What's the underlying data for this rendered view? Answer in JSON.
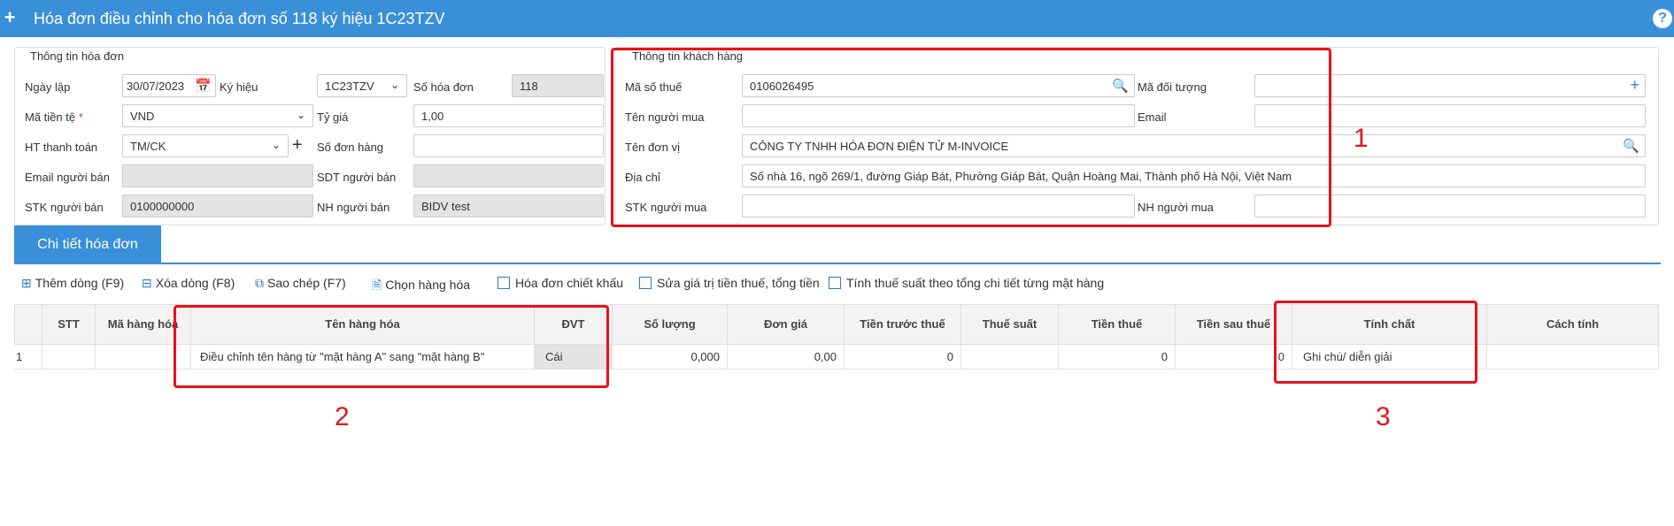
{
  "title": "Hóa đơn điều chỉnh cho hóa đơn số 118 ký hiệu 1C23TZV",
  "invoice_info": {
    "legend": "Thông tin hóa đơn",
    "ngay_lap_label": "Ngày lập",
    "ngay_lap": "30/07/2023",
    "ky_hieu_label": "Ký hiệu",
    "ky_hieu": "1C23TZV",
    "so_hoa_don_label": "Số hóa đơn",
    "so_hoa_don": "118",
    "ma_tien_te_label": "Mã tiền tệ",
    "ma_tien_te": "VND",
    "ty_gia_label": "Tỷ giá",
    "ty_gia": "1,00",
    "ht_thanh_toan_label": "HT thanh toán",
    "ht_thanh_toan": "TM/CK",
    "so_don_hang_label": "Số đơn hàng",
    "so_don_hang": "",
    "email_nguoi_ban_label": "Email người bán",
    "email_nguoi_ban": "",
    "sdt_nguoi_ban_label": "SDT người bán",
    "sdt_nguoi_ban": "",
    "stk_nguoi_ban_label": "STK người bán",
    "stk_nguoi_ban": "0100000000",
    "nh_nguoi_ban_label": "NH người bán",
    "nh_nguoi_ban": "BIDV test"
  },
  "customer_info": {
    "legend": "Thông tin khách hàng",
    "ma_so_thue_label": "Mã số thuế",
    "ma_so_thue": "0106026495",
    "ma_doi_tuong_label": "Mã đối tượng",
    "ma_doi_tuong": "",
    "ten_nguoi_mua_label": "Tên người mua",
    "ten_nguoi_mua": "",
    "email_label": "Email",
    "email": "",
    "ten_don_vi_label": "Tên đơn vị",
    "ten_don_vi": "CÔNG TY TNHH HÓA ĐƠN ĐIỆN TỬ M-INVOICE",
    "dia_chi_label": "Địa chỉ",
    "dia_chi": "Số nhà 16, ngõ 269/1, đường Giáp Bát, Phường Giáp Bát, Quận Hoàng Mai, Thành phố Hà Nội, Việt Nam",
    "stk_nguoi_mua_label": "STK người mua",
    "stk_nguoi_mua": "",
    "nh_nguoi_mua_label": "NH người mua",
    "nh_nguoi_mua": ""
  },
  "tab": "Chi tiết hóa đơn",
  "toolbar": {
    "add_row": "Thêm dòng (F9)",
    "delete_row": "Xóa dòng (F8)",
    "copy": "Sao chép (F7)",
    "choose_goods": "Chọn hàng hóa",
    "discount_invoice": "Hóa đơn chiết khấu",
    "edit_tax_total": "Sửa giá trị tiền thuế, tổng tiền",
    "calc_tax_rate": "Tính thuế suất theo tổng chi tiết từng mặt hàng"
  },
  "grid": {
    "headers": [
      "STT",
      "Mã hàng hóa",
      "Tên hàng hóa",
      "ĐVT",
      "Số lượng",
      "Đơn giá",
      "Tiền trước thuế",
      "Thuế suất",
      "Tiền thuế",
      "Tiền sau thuế",
      "Tính chất",
      "Cách tính"
    ],
    "row": {
      "index": "1",
      "stt": "",
      "ma": "",
      "ten": "Điều chỉnh tên hàng từ \"mặt hàng A\" sang \"mặt hàng B\"",
      "dvt": "Cái",
      "so_luong": "0,000",
      "don_gia": "0,00",
      "tien_truoc_thue": "0",
      "thue_suat": "",
      "tien_thue": "0",
      "tien_sau_thue": "0",
      "tinh_chat": "Ghi chú/ diễn giải",
      "cach_tinh": ""
    }
  },
  "annotations": [
    "1",
    "2",
    "3"
  ],
  "colors": {
    "header_blue": "#3a8fd9",
    "highlight_red": "#e8121b"
  }
}
